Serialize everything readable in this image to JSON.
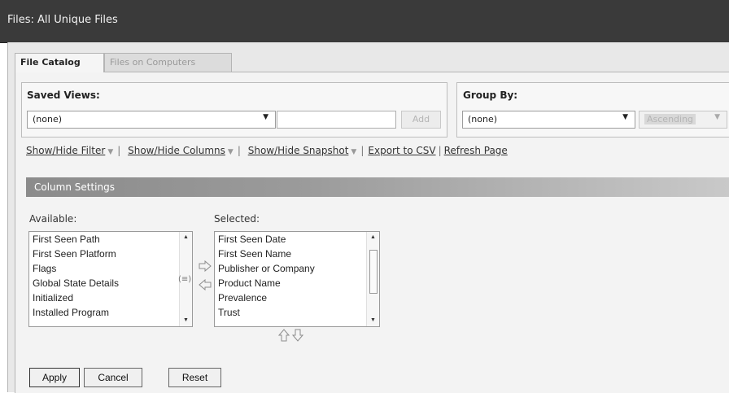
{
  "window": {
    "title": "Files: All Unique Files"
  },
  "tabs": [
    {
      "label": "File Catalog",
      "active": true
    },
    {
      "label": "Files on Computers",
      "active": false
    }
  ],
  "saved_views": {
    "title": "Saved Views:",
    "selected": "(none)",
    "name_value": "",
    "add_label": "Add"
  },
  "group_by": {
    "title": "Group By:",
    "selected": "(none)",
    "order": "Ascending"
  },
  "links": {
    "show_hide_filter": "Show/Hide Filter",
    "show_hide_columns": "Show/Hide Columns",
    "show_hide_snapshot": "Show/Hide Snapshot",
    "export_csv": "Export to CSV",
    "refresh_page": "Refresh Page"
  },
  "column_settings": {
    "title": "Column Settings",
    "available_label": "Available:",
    "selected_label": "Selected:",
    "available": [
      "First Seen Path",
      "First Seen Platform",
      "Flags",
      "Global State Details",
      "Initialized",
      "Installed Program"
    ],
    "selected": [
      "First Seen Date",
      "First Seen Name",
      "Publisher or Company",
      "Product Name",
      "Prevalence",
      "Trust"
    ]
  },
  "buttons": {
    "apply": "Apply",
    "cancel": "Cancel",
    "reset": "Reset"
  },
  "icons": {
    "dropdown": "chevron-down-icon",
    "move_right": "arrow-right-icon",
    "move_left": "arrow-left-icon",
    "move_up": "arrow-up-icon",
    "move_down": "arrow-down-icon"
  },
  "colors": {
    "titlebar": "#3a3a3a",
    "settings_bar": "#8b8b8b"
  }
}
